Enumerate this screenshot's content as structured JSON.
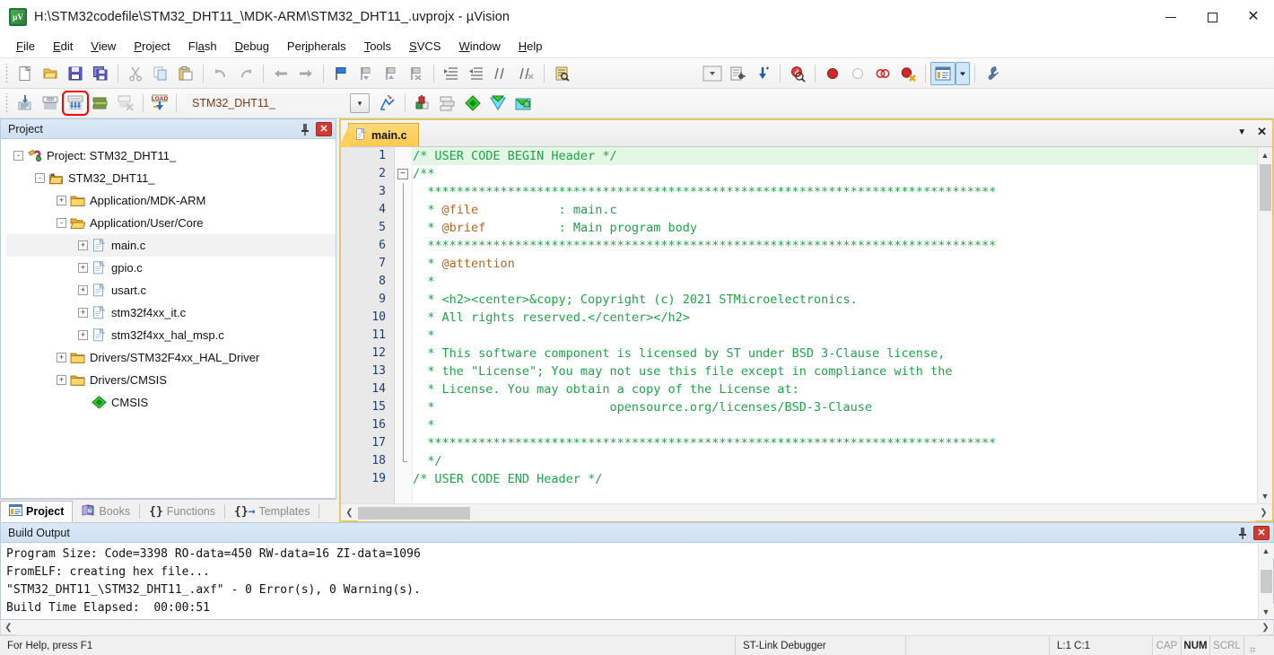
{
  "window": {
    "title": "H:\\STM32codefile\\STM32_DHT11_\\MDK-ARM\\STM32_DHT11_.uvprojx - µVision",
    "app_icon": "uvision-icon",
    "minimize_label": "Minimize",
    "maximize_label": "Maximize",
    "close_label": "Close"
  },
  "menubar": {
    "items": [
      {
        "label": "File",
        "accel": "F"
      },
      {
        "label": "Edit",
        "accel": "E"
      },
      {
        "label": "View",
        "accel": "V"
      },
      {
        "label": "Project",
        "accel": "P"
      },
      {
        "label": "Flash",
        "accel": "a"
      },
      {
        "label": "Debug",
        "accel": "D"
      },
      {
        "label": "Peripherals",
        "accel": "i"
      },
      {
        "label": "Tools",
        "accel": "T"
      },
      {
        "label": "SVCS",
        "accel": "S"
      },
      {
        "label": "Window",
        "accel": "W"
      },
      {
        "label": "Help",
        "accel": "H"
      }
    ]
  },
  "toolbar_main": {
    "buttons": [
      {
        "name": "new-file-icon",
        "tip": "New"
      },
      {
        "name": "open-file-icon",
        "tip": "Open"
      },
      {
        "name": "save-icon",
        "tip": "Save"
      },
      {
        "name": "save-all-icon",
        "tip": "Save All"
      },
      {
        "name": "cut-icon",
        "tip": "Cut"
      },
      {
        "name": "copy-icon",
        "tip": "Copy"
      },
      {
        "name": "paste-icon",
        "tip": "Paste"
      },
      {
        "name": "undo-icon",
        "tip": "Undo"
      },
      {
        "name": "redo-icon",
        "tip": "Redo"
      },
      {
        "name": "navigate-back-icon",
        "tip": "Back"
      },
      {
        "name": "navigate-forward-icon",
        "tip": "Forward"
      },
      {
        "name": "bookmark-toggle-icon",
        "tip": "Insert/Remove Bookmark"
      },
      {
        "name": "bookmark-prev-icon",
        "tip": "Go to Previous Bookmark"
      },
      {
        "name": "bookmark-next-icon",
        "tip": "Go to Next Bookmark"
      },
      {
        "name": "bookmark-clear-icon",
        "tip": "Clear All Bookmarks"
      },
      {
        "name": "indent-right-icon",
        "tip": "Indent Selection"
      },
      {
        "name": "indent-left-icon",
        "tip": "Unindent Selection"
      },
      {
        "name": "comment-icon",
        "tip": "Comment Selection"
      },
      {
        "name": "uncomment-icon",
        "tip": "Uncomment Selection"
      },
      {
        "name": "find-in-files-icon",
        "tip": "Find in Files"
      }
    ],
    "right_buttons": [
      {
        "name": "debug-dropdown-icon",
        "tip": "Debug Settings"
      },
      {
        "name": "config-wizard-icon",
        "tip": "Configuration Wizard"
      },
      {
        "name": "download-icon",
        "tip": "Download"
      },
      {
        "name": "start-debug-icon",
        "tip": "Start/Stop Debug Session"
      },
      {
        "name": "breakpoint-insert-icon",
        "tip": "Insert/Remove Breakpoint"
      },
      {
        "name": "breakpoint-enable-icon",
        "tip": "Enable/Disable Breakpoint"
      },
      {
        "name": "breakpoint-disable-all-icon",
        "tip": "Disable All Breakpoints"
      },
      {
        "name": "breakpoint-kill-all-icon",
        "tip": "Kill All Breakpoints"
      },
      {
        "name": "project-window-icon",
        "tip": "Project Window"
      },
      {
        "name": "project-window-dropdown-icon",
        "tip": "More windows"
      },
      {
        "name": "configure-icon",
        "tip": "Configure"
      }
    ]
  },
  "toolbar_build": {
    "buttons": [
      {
        "name": "translate-icon",
        "tip": "Translate",
        "highlighted": false
      },
      {
        "name": "build-icon",
        "tip": "Build",
        "highlighted": false
      },
      {
        "name": "rebuild-icon",
        "tip": "Rebuild",
        "highlighted": true
      },
      {
        "name": "batch-build-icon",
        "tip": "Batch Build",
        "highlighted": false
      },
      {
        "name": "stop-build-icon",
        "tip": "Stop Build",
        "highlighted": false
      },
      {
        "name": "download-load-icon",
        "tip": "Download to Flash",
        "highlighted": false
      }
    ],
    "target_select": {
      "value": "STM32_DHT11_",
      "name": "target-select"
    },
    "right_buttons": [
      {
        "name": "target-options-icon",
        "tip": "Options for Target"
      },
      {
        "name": "manage-project-items-icon",
        "tip": "Manage Project Items"
      },
      {
        "name": "manage-runtime-env-icon",
        "tip": "Manage Run-Time Environment"
      },
      {
        "name": "select-software-packs-icon",
        "tip": "Select Software Packs"
      },
      {
        "name": "pack-installer-icon",
        "tip": "Pack Installer"
      }
    ]
  },
  "project_pane": {
    "title": "Project",
    "pin_label": "Auto Hide",
    "close_label": "Close",
    "tree": [
      {
        "depth": 0,
        "toggle": "-",
        "icon": "project-icon",
        "label": "Project: STM32_DHT11_",
        "selected": false
      },
      {
        "depth": 1,
        "toggle": "-",
        "icon": "target-icon",
        "label": "STM32_DHT11_",
        "selected": false
      },
      {
        "depth": 2,
        "toggle": "+",
        "icon": "folder-closed-icon",
        "label": "Application/MDK-ARM",
        "selected": false
      },
      {
        "depth": 2,
        "toggle": "-",
        "icon": "folder-open-icon",
        "label": "Application/User/Core",
        "selected": false
      },
      {
        "depth": 3,
        "toggle": "+",
        "icon": "c-file-icon",
        "label": "main.c",
        "selected": true
      },
      {
        "depth": 3,
        "toggle": "+",
        "icon": "c-file-icon",
        "label": "gpio.c",
        "selected": false
      },
      {
        "depth": 3,
        "toggle": "+",
        "icon": "c-file-icon",
        "label": "usart.c",
        "selected": false
      },
      {
        "depth": 3,
        "toggle": "+",
        "icon": "c-file-icon",
        "label": "stm32f4xx_it.c",
        "selected": false
      },
      {
        "depth": 3,
        "toggle": "+",
        "icon": "c-file-icon",
        "label": "stm32f4xx_hal_msp.c",
        "selected": false
      },
      {
        "depth": 2,
        "toggle": "+",
        "icon": "folder-closed-icon",
        "label": "Drivers/STM32F4xx_HAL_Driver",
        "selected": false
      },
      {
        "depth": 2,
        "toggle": "+",
        "icon": "folder-closed-icon",
        "label": "Drivers/CMSIS",
        "selected": false
      },
      {
        "depth": 3,
        "toggle": "",
        "icon": "cmsis-icon",
        "label": "CMSIS",
        "selected": false
      }
    ],
    "tabs": [
      {
        "label": "Project",
        "icon": "project-tab-icon",
        "active": true
      },
      {
        "label": "Books",
        "icon": "books-tab-icon",
        "active": false
      },
      {
        "label": "Functions",
        "icon": "functions-tab-icon",
        "active": false
      },
      {
        "label": "Templates",
        "icon": "templates-tab-icon",
        "active": false
      }
    ]
  },
  "editor": {
    "tabs": [
      {
        "label": "main.c",
        "icon": "c-file-icon",
        "active": true
      }
    ],
    "tab_menu_label": "Window list",
    "tab_close_label": "Close",
    "first_line": 1,
    "lines": [
      {
        "n": 1,
        "fold": "",
        "highlight": true,
        "segments": [
          {
            "t": "/* USER CODE BEGIN Header */",
            "c": "comment"
          }
        ]
      },
      {
        "n": 2,
        "fold": "-",
        "highlight": false,
        "segments": [
          {
            "t": "/**",
            "c": "comment"
          }
        ]
      },
      {
        "n": 3,
        "fold": "|",
        "highlight": false,
        "segments": [
          {
            "t": "  ******************************************************************************",
            "c": "comment"
          }
        ]
      },
      {
        "n": 4,
        "fold": "|",
        "highlight": false,
        "segments": [
          {
            "t": "  * ",
            "c": "comment"
          },
          {
            "t": "@file",
            "c": "tag"
          },
          {
            "t": "           : main.c",
            "c": "comment"
          }
        ]
      },
      {
        "n": 5,
        "fold": "|",
        "highlight": false,
        "segments": [
          {
            "t": "  * ",
            "c": "comment"
          },
          {
            "t": "@brief",
            "c": "tag"
          },
          {
            "t": "          : Main program body",
            "c": "comment"
          }
        ]
      },
      {
        "n": 6,
        "fold": "|",
        "highlight": false,
        "segments": [
          {
            "t": "  ******************************************************************************",
            "c": "comment"
          }
        ]
      },
      {
        "n": 7,
        "fold": "|",
        "highlight": false,
        "segments": [
          {
            "t": "  * ",
            "c": "comment"
          },
          {
            "t": "@attention",
            "c": "tag"
          }
        ]
      },
      {
        "n": 8,
        "fold": "|",
        "highlight": false,
        "segments": [
          {
            "t": "  *",
            "c": "comment"
          }
        ]
      },
      {
        "n": 9,
        "fold": "|",
        "highlight": false,
        "segments": [
          {
            "t": "  * <h2><center>&copy; Copyright (c) 2021 STMicroelectronics.",
            "c": "comment"
          }
        ]
      },
      {
        "n": 10,
        "fold": "|",
        "highlight": false,
        "segments": [
          {
            "t": "  * All rights reserved.</center></h2>",
            "c": "comment"
          }
        ]
      },
      {
        "n": 11,
        "fold": "|",
        "highlight": false,
        "segments": [
          {
            "t": "  *",
            "c": "comment"
          }
        ]
      },
      {
        "n": 12,
        "fold": "|",
        "highlight": false,
        "segments": [
          {
            "t": "  * This software component is licensed by ST under BSD 3-Clause license,",
            "c": "comment"
          }
        ]
      },
      {
        "n": 13,
        "fold": "|",
        "highlight": false,
        "segments": [
          {
            "t": "  * the \"License\"; You may not use this file except in compliance with the",
            "c": "comment"
          }
        ]
      },
      {
        "n": 14,
        "fold": "|",
        "highlight": false,
        "segments": [
          {
            "t": "  * License. You may obtain a copy of the License at:",
            "c": "comment"
          }
        ]
      },
      {
        "n": 15,
        "fold": "|",
        "highlight": false,
        "segments": [
          {
            "t": "  *                        opensource.org/licenses/BSD-3-Clause",
            "c": "comment"
          }
        ]
      },
      {
        "n": 16,
        "fold": "|",
        "highlight": false,
        "segments": [
          {
            "t": "  *",
            "c": "comment"
          }
        ]
      },
      {
        "n": 17,
        "fold": "|",
        "highlight": false,
        "segments": [
          {
            "t": "  ******************************************************************************",
            "c": "comment"
          }
        ]
      },
      {
        "n": 18,
        "fold": "L",
        "highlight": false,
        "segments": [
          {
            "t": "  */",
            "c": "comment"
          }
        ]
      }
    ]
  },
  "build_output": {
    "title": "Build Output",
    "pin_label": "Auto Hide",
    "close_label": "Close",
    "lines": [
      "Program Size: Code=3398 RO-data=450 RW-data=16 ZI-data=1096",
      "FromELF: creating hex file...",
      "\"STM32_DHT11_\\STM32_DHT11_.axf\" - 0 Error(s), 0 Warning(s).",
      "Build Time Elapsed:  00:00:51"
    ]
  },
  "statusbar": {
    "help_text": "For Help, press F1",
    "debugger": "ST-Link Debugger",
    "extra": "",
    "cursor": "L:1 C:1",
    "indicators": [
      {
        "label": "CAP",
        "active": false
      },
      {
        "label": "NUM",
        "active": true
      },
      {
        "label": "SCRL",
        "active": false
      }
    ]
  },
  "colors": {
    "accent_tab": "#ffc94d",
    "comment_green": "#1fa34a",
    "doc_tag_brown": "#b5651d",
    "close_red": "#cf3a32",
    "line_number": "#1c3f6e",
    "highlight_line": "#e4f7e4",
    "pane_header": "#cfe0f2"
  }
}
